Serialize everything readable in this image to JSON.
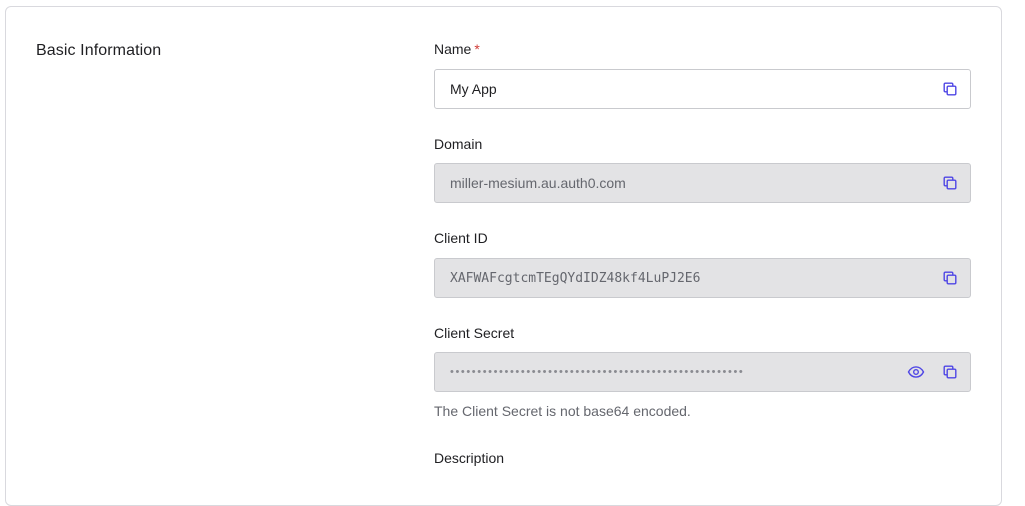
{
  "section": {
    "title": "Basic Information"
  },
  "fields": {
    "name": {
      "label": "Name",
      "required_mark": "*",
      "value": "My App"
    },
    "domain": {
      "label": "Domain",
      "value": "miller-mesium.au.auth0.com"
    },
    "client_id": {
      "label": "Client ID",
      "value": "XAFWAFcgtcmTEgQYdIDZ48kf4LuPJ2E6"
    },
    "client_secret": {
      "label": "Client Secret",
      "value": "••••••••••••••••••••••••••••••••••••••••••••••••••••••",
      "hint": "The Client Secret is not base64 encoded."
    },
    "description": {
      "label": "Description"
    }
  },
  "icons": {
    "copy": "copy-icon",
    "reveal": "eye-icon"
  },
  "colors": {
    "accent": "#4f46e5",
    "required": "#d03c38",
    "readonly_bg": "#e3e3e5"
  }
}
